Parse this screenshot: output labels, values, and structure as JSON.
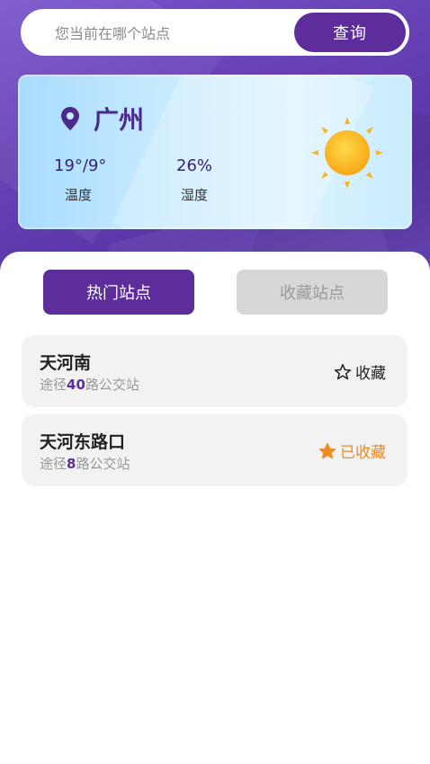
{
  "search": {
    "placeholder": "您当前在哪个站点",
    "button_label": "查询"
  },
  "weather": {
    "city": "广州",
    "temperature": "19°/9°",
    "temperature_label": "温度",
    "humidity": "26%",
    "humidity_label": "湿度",
    "icon": "sun-icon"
  },
  "tabs": [
    {
      "label": "热门站点",
      "active": true
    },
    {
      "label": "收藏站点",
      "active": false
    }
  ],
  "stations": [
    {
      "name": "天河南",
      "route_prefix": "途径",
      "route_count": "40",
      "route_suffix": "路公交站",
      "fav_label": "收藏",
      "favorited": false
    },
    {
      "name": "天河东路口",
      "route_prefix": "途径",
      "route_count": "8",
      "route_suffix": "路公交站",
      "fav_label": "已收藏",
      "favorited": true
    }
  ],
  "colors": {
    "brand": "#5c2d9b",
    "favorited": "#f08a1c"
  }
}
